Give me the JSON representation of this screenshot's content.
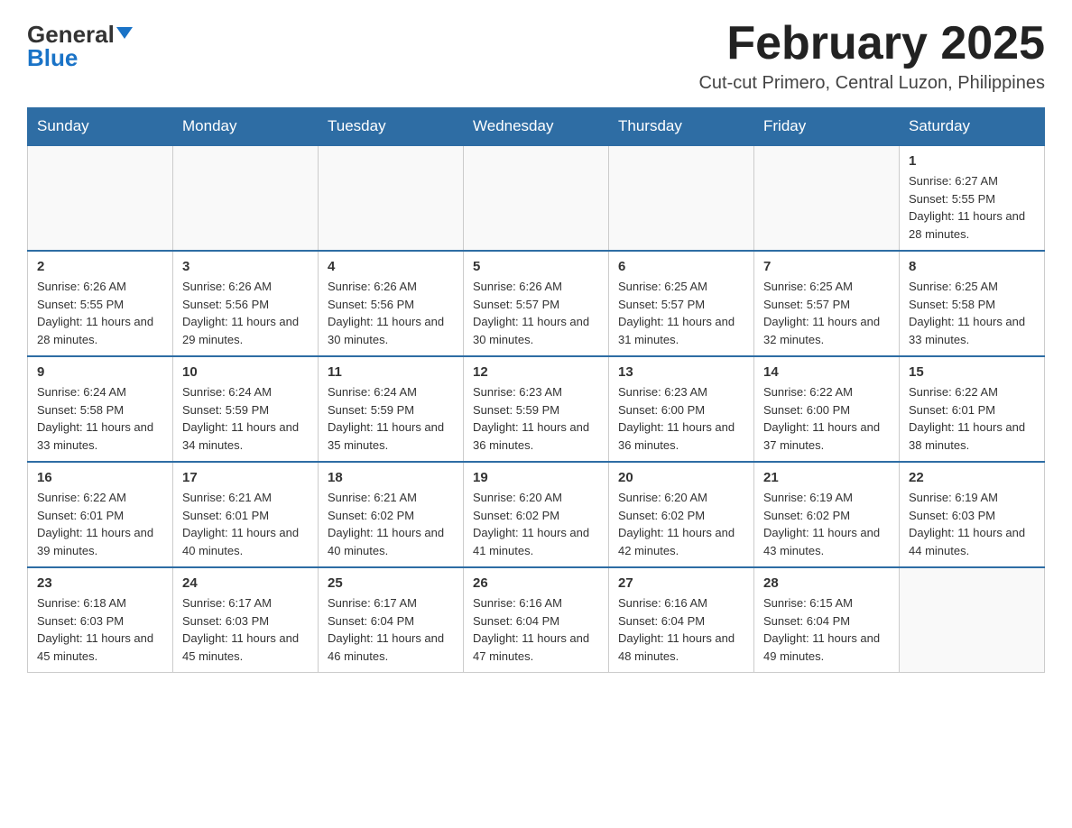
{
  "header": {
    "logo_general": "General",
    "logo_blue": "Blue",
    "month_title": "February 2025",
    "subtitle": "Cut-cut Primero, Central Luzon, Philippines"
  },
  "days_of_week": [
    "Sunday",
    "Monday",
    "Tuesday",
    "Wednesday",
    "Thursday",
    "Friday",
    "Saturday"
  ],
  "weeks": [
    [
      {
        "day": "",
        "info": ""
      },
      {
        "day": "",
        "info": ""
      },
      {
        "day": "",
        "info": ""
      },
      {
        "day": "",
        "info": ""
      },
      {
        "day": "",
        "info": ""
      },
      {
        "day": "",
        "info": ""
      },
      {
        "day": "1",
        "info": "Sunrise: 6:27 AM\nSunset: 5:55 PM\nDaylight: 11 hours and 28 minutes."
      }
    ],
    [
      {
        "day": "2",
        "info": "Sunrise: 6:26 AM\nSunset: 5:55 PM\nDaylight: 11 hours and 28 minutes."
      },
      {
        "day": "3",
        "info": "Sunrise: 6:26 AM\nSunset: 5:56 PM\nDaylight: 11 hours and 29 minutes."
      },
      {
        "day": "4",
        "info": "Sunrise: 6:26 AM\nSunset: 5:56 PM\nDaylight: 11 hours and 30 minutes."
      },
      {
        "day": "5",
        "info": "Sunrise: 6:26 AM\nSunset: 5:57 PM\nDaylight: 11 hours and 30 minutes."
      },
      {
        "day": "6",
        "info": "Sunrise: 6:25 AM\nSunset: 5:57 PM\nDaylight: 11 hours and 31 minutes."
      },
      {
        "day": "7",
        "info": "Sunrise: 6:25 AM\nSunset: 5:57 PM\nDaylight: 11 hours and 32 minutes."
      },
      {
        "day": "8",
        "info": "Sunrise: 6:25 AM\nSunset: 5:58 PM\nDaylight: 11 hours and 33 minutes."
      }
    ],
    [
      {
        "day": "9",
        "info": "Sunrise: 6:24 AM\nSunset: 5:58 PM\nDaylight: 11 hours and 33 minutes."
      },
      {
        "day": "10",
        "info": "Sunrise: 6:24 AM\nSunset: 5:59 PM\nDaylight: 11 hours and 34 minutes."
      },
      {
        "day": "11",
        "info": "Sunrise: 6:24 AM\nSunset: 5:59 PM\nDaylight: 11 hours and 35 minutes."
      },
      {
        "day": "12",
        "info": "Sunrise: 6:23 AM\nSunset: 5:59 PM\nDaylight: 11 hours and 36 minutes."
      },
      {
        "day": "13",
        "info": "Sunrise: 6:23 AM\nSunset: 6:00 PM\nDaylight: 11 hours and 36 minutes."
      },
      {
        "day": "14",
        "info": "Sunrise: 6:22 AM\nSunset: 6:00 PM\nDaylight: 11 hours and 37 minutes."
      },
      {
        "day": "15",
        "info": "Sunrise: 6:22 AM\nSunset: 6:01 PM\nDaylight: 11 hours and 38 minutes."
      }
    ],
    [
      {
        "day": "16",
        "info": "Sunrise: 6:22 AM\nSunset: 6:01 PM\nDaylight: 11 hours and 39 minutes."
      },
      {
        "day": "17",
        "info": "Sunrise: 6:21 AM\nSunset: 6:01 PM\nDaylight: 11 hours and 40 minutes."
      },
      {
        "day": "18",
        "info": "Sunrise: 6:21 AM\nSunset: 6:02 PM\nDaylight: 11 hours and 40 minutes."
      },
      {
        "day": "19",
        "info": "Sunrise: 6:20 AM\nSunset: 6:02 PM\nDaylight: 11 hours and 41 minutes."
      },
      {
        "day": "20",
        "info": "Sunrise: 6:20 AM\nSunset: 6:02 PM\nDaylight: 11 hours and 42 minutes."
      },
      {
        "day": "21",
        "info": "Sunrise: 6:19 AM\nSunset: 6:02 PM\nDaylight: 11 hours and 43 minutes."
      },
      {
        "day": "22",
        "info": "Sunrise: 6:19 AM\nSunset: 6:03 PM\nDaylight: 11 hours and 44 minutes."
      }
    ],
    [
      {
        "day": "23",
        "info": "Sunrise: 6:18 AM\nSunset: 6:03 PM\nDaylight: 11 hours and 45 minutes."
      },
      {
        "day": "24",
        "info": "Sunrise: 6:17 AM\nSunset: 6:03 PM\nDaylight: 11 hours and 45 minutes."
      },
      {
        "day": "25",
        "info": "Sunrise: 6:17 AM\nSunset: 6:04 PM\nDaylight: 11 hours and 46 minutes."
      },
      {
        "day": "26",
        "info": "Sunrise: 6:16 AM\nSunset: 6:04 PM\nDaylight: 11 hours and 47 minutes."
      },
      {
        "day": "27",
        "info": "Sunrise: 6:16 AM\nSunset: 6:04 PM\nDaylight: 11 hours and 48 minutes."
      },
      {
        "day": "28",
        "info": "Sunrise: 6:15 AM\nSunset: 6:04 PM\nDaylight: 11 hours and 49 minutes."
      },
      {
        "day": "",
        "info": ""
      }
    ]
  ]
}
